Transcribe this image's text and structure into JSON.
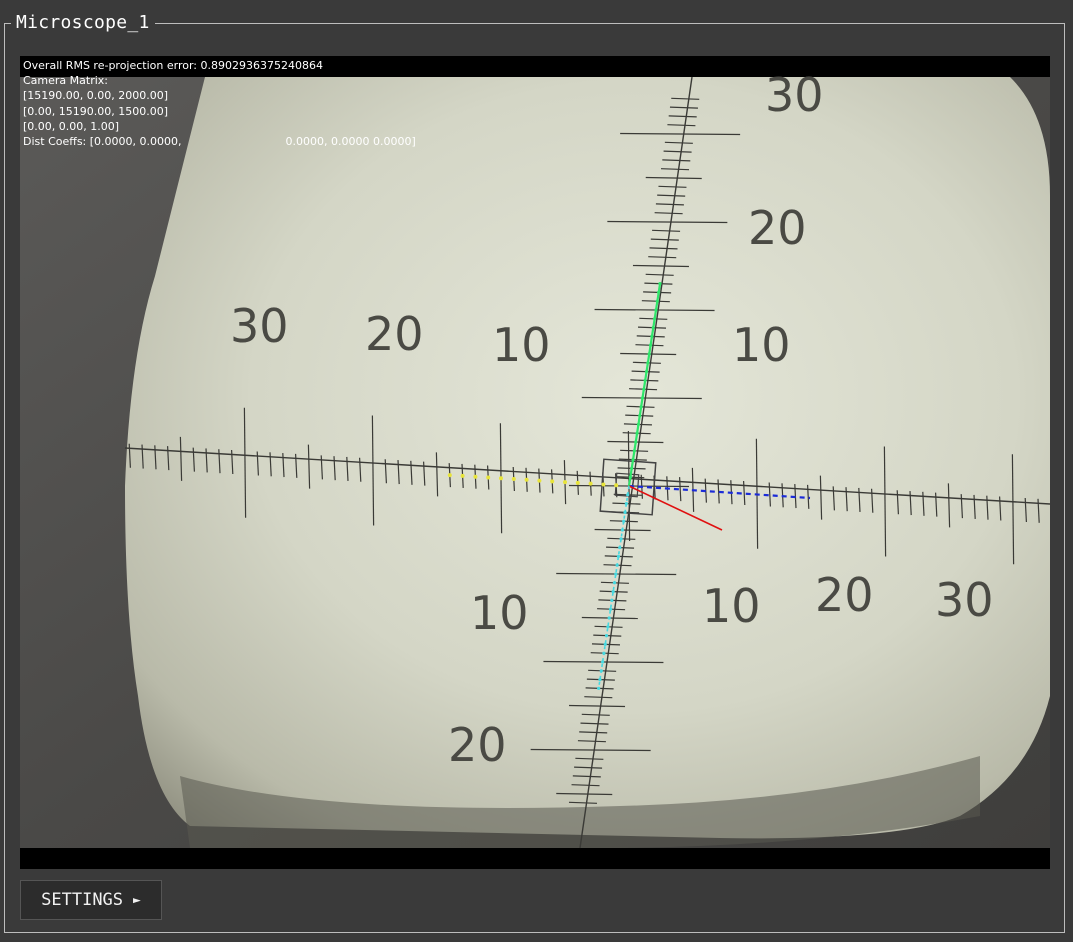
{
  "panel": {
    "title": "Microscope_1"
  },
  "overlay": {
    "rms_line": "Overall RMS re-projection error: 0.8902936375240864",
    "matrix_label": "Camera Matrix:",
    "matrix_row1": "[15190.00, 0.00, 2000.00]",
    "matrix_row2": "[0.00, 15190.00, 1500.00]",
    "matrix_row3": "[0.00, 0.00, 1.00]",
    "dist_prefix": "Dist Coeffs: [0.0000, 0.0000,",
    "dist_suffix": "0.0000, 0.0000 0.0000]"
  },
  "reticle": {
    "horizontal_labels": [
      "30",
      "20",
      "10",
      "10",
      "20",
      "30"
    ],
    "vertical_labels_top": [
      "30",
      "20",
      "10"
    ],
    "vertical_labels_bottom": [
      "10",
      "20"
    ]
  },
  "colors": {
    "axis_x_marker": "#1b2bd8",
    "axis_y_marker": "#2ee66a",
    "axis_z_marker": "#e01010",
    "points_left": "#e8e43a",
    "points_bottom": "#46d8e0"
  },
  "buttons": {
    "settings_label": "SETTINGS",
    "settings_icon": "►"
  }
}
